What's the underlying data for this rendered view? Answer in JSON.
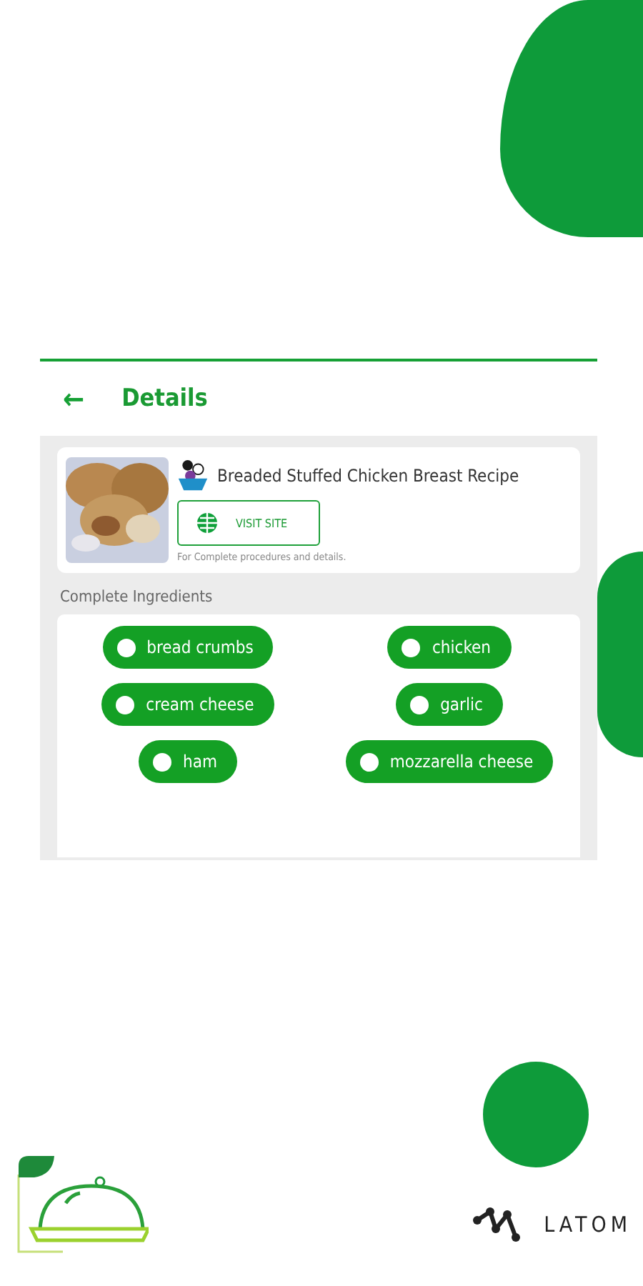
{
  "header": {
    "back_icon": "←",
    "title": "Details"
  },
  "recipe": {
    "title": "Breaded Stuffed Chicken Breast Recipe",
    "button": "VISIT SITE",
    "note": "For Complete procedures and details."
  },
  "ingredients_heading": "Complete Ingredients",
  "ingredients": [
    "bread crumbs",
    "chicken",
    "cream cheese",
    "garlic",
    "ham",
    "mozzarella cheese"
  ],
  "brand": "LATOM"
}
